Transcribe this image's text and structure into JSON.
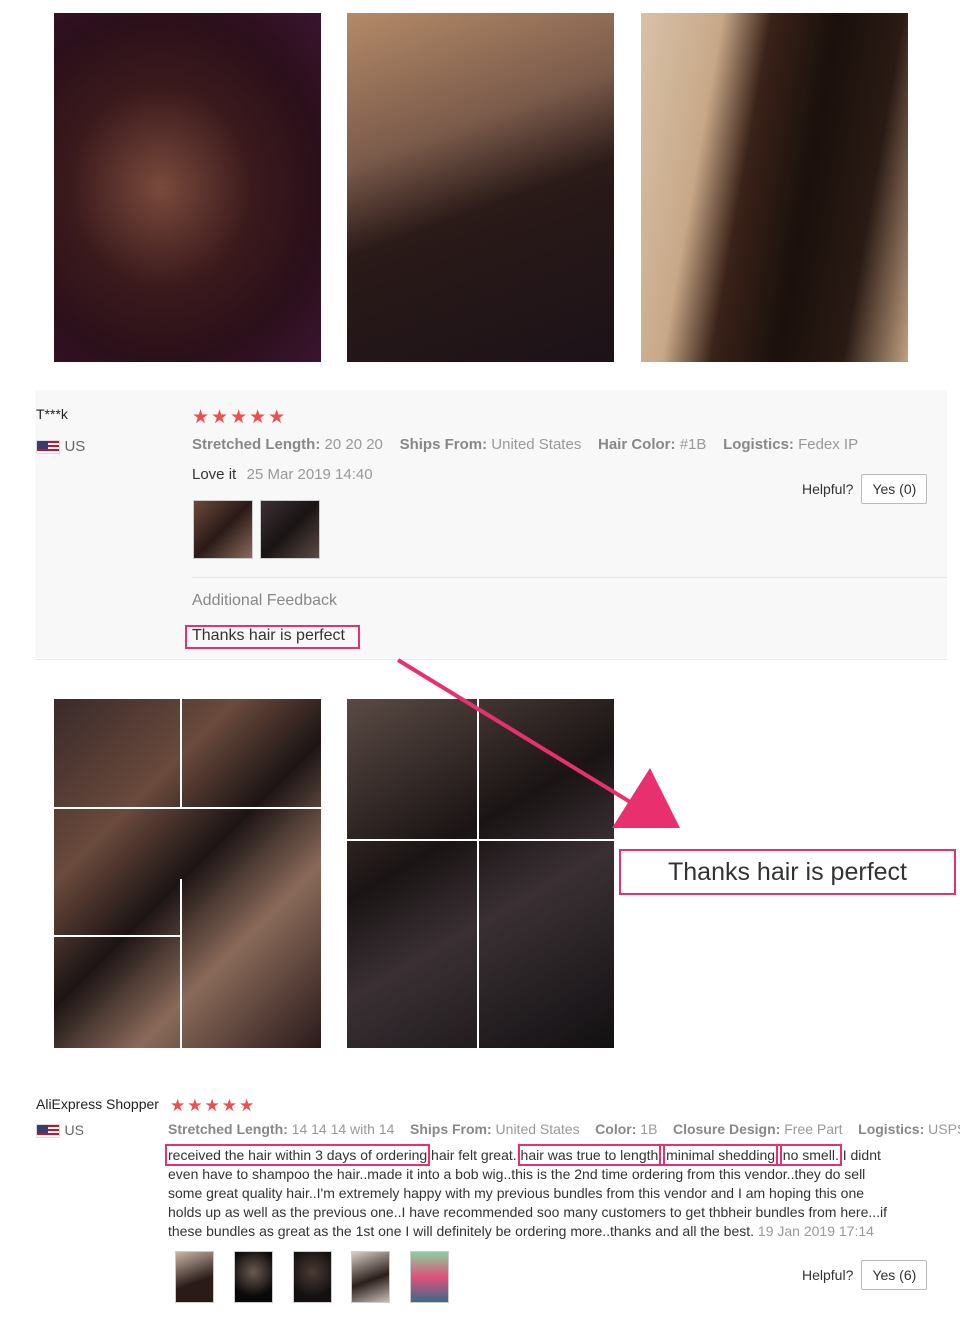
{
  "review1": {
    "reviewer": "T***k",
    "country": "US",
    "stars": "★★★★★",
    "attributes": [
      {
        "label": "Stretched Length:",
        "value": "20 20 20"
      },
      {
        "label": "Ships From:",
        "value": "United States"
      },
      {
        "label": "Hair Color:",
        "value": "#1B"
      },
      {
        "label": "Logistics:",
        "value": "Fedex IP"
      }
    ],
    "text": "Love it",
    "date": "25 Mar 2019 14:40",
    "helpful_label": "Helpful?",
    "yes_label": "Yes (0)",
    "additional_feedback_title": "Additional Feedback",
    "additional_feedback_text": "Thanks hair is perfect"
  },
  "callout_text": "Thanks hair is perfect",
  "review2": {
    "reviewer": "AliExpress Shopper",
    "country": "US",
    "stars": "★★★★★",
    "attributes": [
      {
        "label": "Stretched Length:",
        "value": "14 14 14 with 14"
      },
      {
        "label": "Ships From:",
        "value": "United States"
      },
      {
        "label": "Color:",
        "value": "1B"
      },
      {
        "label": "Closure Design:",
        "value": "Free Part"
      },
      {
        "label": "Logistics:",
        "value": "USPS"
      }
    ],
    "text_parts": [
      "received the hair within 3 days of ordering",
      ".hair felt great..",
      "hair was true to length.",
      ".minimal shedding.",
      ".no smell.",
      ".I didnt"
    ],
    "text_lines": [
      "even have to shampoo the hair..made it into a bob wig..this is the 2nd time ordering from this vendor..they do sell",
      "some great quality hair..I'm extremely happy with my previous bundles from this vendor and I am hoping this one",
      "holds up as well as the previous one..I have recommended soo many customers to get thbheir bundles from here...if",
      "these bundles as great as the 1st one I will definitely be ordering more..thanks and all the best."
    ],
    "date": "19 Jan 2019 17:14",
    "helpful_label": "Helpful?",
    "yes_label": "Yes (6)"
  },
  "colors": {
    "accent": "#e8306e",
    "star": "#f04e4e"
  }
}
